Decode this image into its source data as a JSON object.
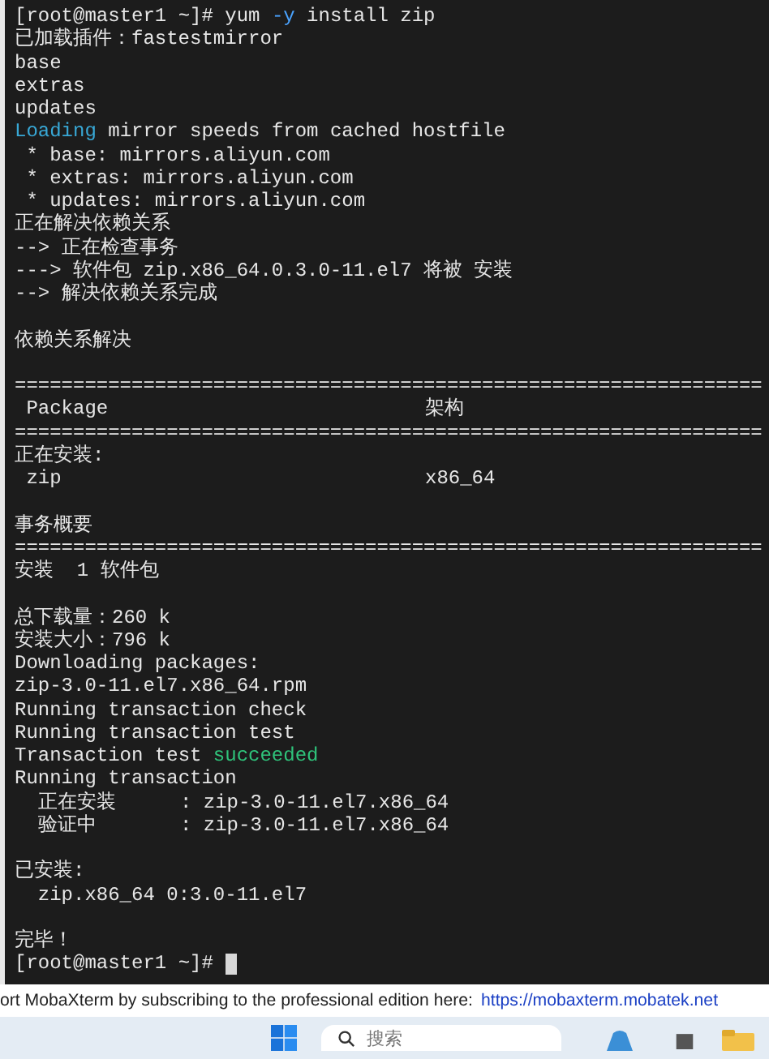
{
  "terminal": {
    "lines": [
      {
        "kind": "text",
        "parts": [
          {
            "text": "[root@master1 ~]# yum ",
            "kind": "plain"
          },
          {
            "text": "-y",
            "kind": "option"
          },
          {
            "text": " install zip",
            "kind": "plain"
          }
        ]
      },
      {
        "kind": "text",
        "parts": [
          {
            "text": "已加载插件：fastestmirror",
            "kind": "plain"
          }
        ]
      },
      {
        "kind": "text",
        "parts": [
          {
            "text": "base",
            "kind": "plain"
          }
        ]
      },
      {
        "kind": "text",
        "parts": [
          {
            "text": "extras",
            "kind": "plain"
          }
        ]
      },
      {
        "kind": "text",
        "parts": [
          {
            "text": "updates",
            "kind": "plain"
          }
        ]
      },
      {
        "kind": "text",
        "parts": [
          {
            "text": "Loading",
            "kind": "info"
          },
          {
            "text": " mirror speeds from cached hostfile",
            "kind": "plain"
          }
        ]
      },
      {
        "kind": "text",
        "parts": [
          {
            "text": " * base: mirrors.aliyun.com",
            "kind": "plain"
          }
        ]
      },
      {
        "kind": "text",
        "parts": [
          {
            "text": " * extras: mirrors.aliyun.com",
            "kind": "plain"
          }
        ]
      },
      {
        "kind": "text",
        "parts": [
          {
            "text": " * updates: mirrors.aliyun.com",
            "kind": "plain"
          }
        ]
      },
      {
        "kind": "text",
        "parts": [
          {
            "text": "正在解决依赖关系",
            "kind": "plain"
          }
        ]
      },
      {
        "kind": "text",
        "parts": [
          {
            "text": "--> 正在检查事务",
            "kind": "plain"
          }
        ]
      },
      {
        "kind": "text",
        "parts": [
          {
            "text": "---> 软件包 zip.x86_64.0.3.0-11.el7 将被 安装",
            "kind": "plain"
          }
        ]
      },
      {
        "kind": "text",
        "parts": [
          {
            "text": "--> 解决依赖关系完成",
            "kind": "plain"
          }
        ]
      },
      {
        "kind": "blank"
      },
      {
        "kind": "text",
        "parts": [
          {
            "text": "依赖关系解决",
            "kind": "plain"
          }
        ]
      },
      {
        "kind": "blank"
      },
      {
        "kind": "text",
        "parts": [
          {
            "text": "================================================================",
            "kind": "plain"
          }
        ]
      },
      {
        "kind": "table_row",
        "cells": [
          " Package",
          "架构"
        ]
      },
      {
        "kind": "text",
        "parts": [
          {
            "text": "================================================================",
            "kind": "plain"
          }
        ]
      },
      {
        "kind": "text",
        "parts": [
          {
            "text": "正在安装:",
            "kind": "plain"
          }
        ]
      },
      {
        "kind": "table_row",
        "cells": [
          " zip",
          "x86_64"
        ]
      },
      {
        "kind": "blank"
      },
      {
        "kind": "text",
        "parts": [
          {
            "text": "事务概要",
            "kind": "plain"
          }
        ]
      },
      {
        "kind": "text",
        "parts": [
          {
            "text": "================================================================",
            "kind": "plain"
          }
        ]
      },
      {
        "kind": "text",
        "parts": [
          {
            "text": "安装  1 软件包",
            "kind": "plain"
          }
        ]
      },
      {
        "kind": "blank"
      },
      {
        "kind": "text",
        "parts": [
          {
            "text": "总下载量：260 k",
            "kind": "plain"
          }
        ]
      },
      {
        "kind": "text",
        "parts": [
          {
            "text": "安装大小：796 k",
            "kind": "plain"
          }
        ]
      },
      {
        "kind": "text",
        "parts": [
          {
            "text": "Downloading packages:",
            "kind": "plain"
          }
        ]
      },
      {
        "kind": "text",
        "parts": [
          {
            "text": "zip-3.0-11.el7.x86_64.rpm",
            "kind": "plain"
          }
        ]
      },
      {
        "kind": "text",
        "parts": [
          {
            "text": "Running transaction check",
            "kind": "plain"
          }
        ]
      },
      {
        "kind": "text",
        "parts": [
          {
            "text": "Running transaction test",
            "kind": "plain"
          }
        ]
      },
      {
        "kind": "text",
        "parts": [
          {
            "text": "Transaction test ",
            "kind": "plain"
          },
          {
            "text": "succeeded",
            "kind": "success"
          }
        ]
      },
      {
        "kind": "text",
        "parts": [
          {
            "text": "Running transaction",
            "kind": "plain"
          }
        ]
      },
      {
        "kind": "step",
        "cells": [
          "  正在安装",
          ": zip-3.0-11.el7.x86_64"
        ]
      },
      {
        "kind": "step",
        "cells": [
          "  验证中",
          ": zip-3.0-11.el7.x86_64"
        ]
      },
      {
        "kind": "blank"
      },
      {
        "kind": "text",
        "parts": [
          {
            "text": "已安装:",
            "kind": "plain"
          }
        ]
      },
      {
        "kind": "text",
        "parts": [
          {
            "text": "  zip.x86_64 0:3.0-11.el7",
            "kind": "plain"
          }
        ]
      },
      {
        "kind": "blank"
      },
      {
        "kind": "text",
        "parts": [
          {
            "text": "完毕！",
            "kind": "plain"
          }
        ]
      },
      {
        "kind": "prompt",
        "parts": [
          {
            "text": "[root@master1 ~]# ",
            "kind": "plain"
          }
        ]
      }
    ]
  },
  "status_bar": {
    "text": "ort MobaXterm by subscribing to the professional edition here:",
    "link": "https://mobaxterm.mobatek.net"
  },
  "taskbar": {
    "search": {
      "placeholder": "搜索"
    }
  }
}
